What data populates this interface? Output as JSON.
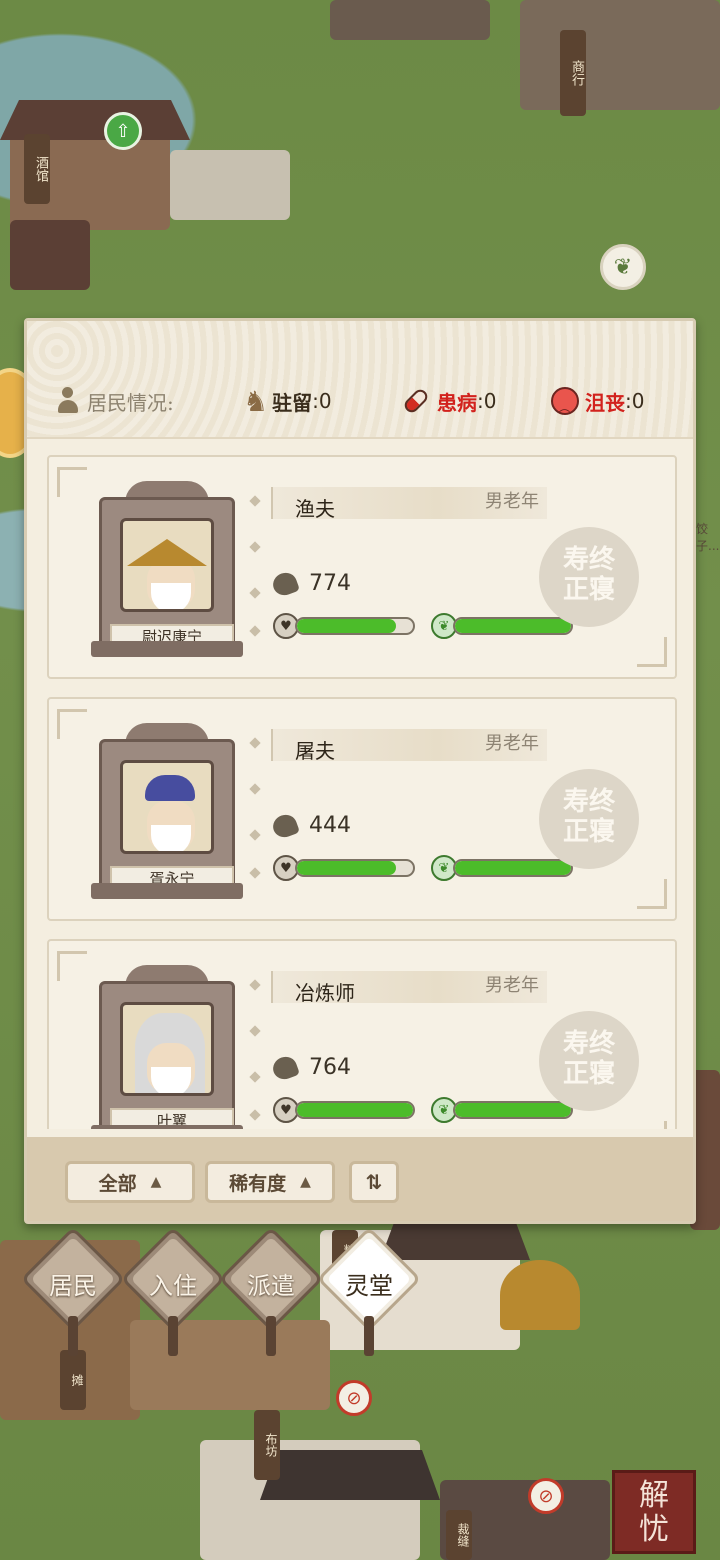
{
  "map": {
    "sign_tavern": "酒馆",
    "sign_shop": "商行",
    "sign_grain": "粮",
    "sign_stall": "摊",
    "sign_cloth": "布坊",
    "sign_tailor": "裁缝",
    "seal_text": "解忧",
    "hint_text": "饺子..."
  },
  "header": {
    "residents_label": "居民情况:",
    "stationed_label": "驻留",
    "stationed_value": ":0",
    "sick_label": "患病",
    "sick_value": ":0",
    "depressed_label": "沮丧",
    "depressed_value": ":0"
  },
  "residents": [
    {
      "name": "尉迟康宁",
      "job": "渔夫",
      "category": "男老年",
      "value": "774",
      "stamp": "寿终正寝",
      "health_pct": 85,
      "mood_pct": 100
    },
    {
      "name": "胥永宁",
      "job": "屠夫",
      "category": "男老年",
      "value": "444",
      "stamp": "寿终正寝",
      "health_pct": 85,
      "mood_pct": 100
    },
    {
      "name": "叶翼",
      "job": "冶炼师",
      "category": "男老年",
      "value": "764",
      "stamp": "寿终正寝",
      "health_pct": 100,
      "mood_pct": 100
    }
  ],
  "filters": {
    "all_label": "全部",
    "rarity_label": "稀有度",
    "sort_icon": "sort-icon"
  },
  "nav": {
    "residents": "居民",
    "move_in": "入住",
    "dispatch": "派遣",
    "memorial": "灵堂"
  },
  "colors": {
    "sick": "#d2221d",
    "bar_fill": "#4cbc2a",
    "panel_bg": "#f4eee0"
  }
}
